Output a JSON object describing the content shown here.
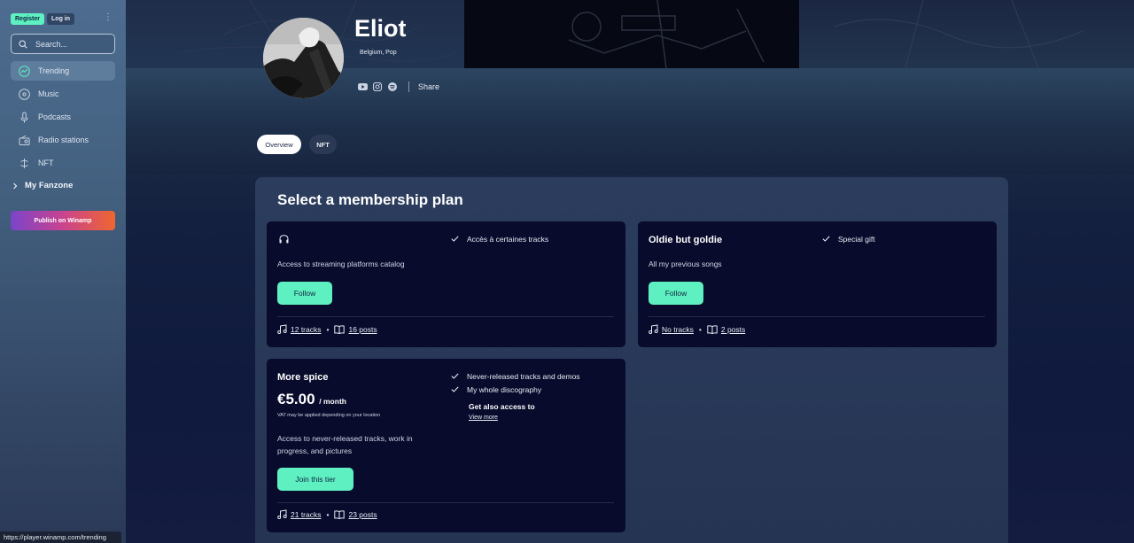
{
  "sidebar": {
    "register_label": "Register",
    "login_label": "Log in",
    "search_placeholder": "Search...",
    "items": [
      {
        "label": "Trending",
        "icon": "trending-icon",
        "active": true
      },
      {
        "label": "Music",
        "icon": "music-disc-icon",
        "active": false
      },
      {
        "label": "Podcasts",
        "icon": "microphone-icon",
        "active": false
      },
      {
        "label": "Radio stations",
        "icon": "radio-icon",
        "active": false
      },
      {
        "label": "NFT",
        "icon": "nft-icon",
        "active": false
      }
    ],
    "fanzone_label": "My Fanzone",
    "publish_label": "Publish on Winamp"
  },
  "status_bar": {
    "url": "https://player.winamp.com/trending"
  },
  "artist": {
    "name": "Eliot",
    "meta": "Belgium, Pop",
    "share_label": "Share",
    "socials": [
      "youtube-icon",
      "instagram-icon",
      "spotify-icon"
    ]
  },
  "tabs": [
    {
      "label": "Overview",
      "active": true
    },
    {
      "label": "NFT",
      "active": false
    }
  ],
  "membership": {
    "title": "Select a membership plan",
    "plans": [
      {
        "title": "",
        "icon": "headphones-icon",
        "features": [
          "Accès à certaines tracks"
        ],
        "description": "Access to streaming platforms catalog",
        "button_label": "Follow",
        "tracks_label": "12 tracks",
        "posts_label": "16 posts"
      },
      {
        "title": "Oldie but goldie",
        "features": [
          "Special gift"
        ],
        "description": "All my previous songs",
        "button_label": "Follow",
        "tracks_label": "No tracks",
        "posts_label": "2 posts"
      },
      {
        "title": "More spice",
        "price": "€5.00",
        "price_unit": "/ month",
        "vat_note": "VAT may be applied depending on your location",
        "features": [
          "Never-released tracks and demos",
          "My whole discography"
        ],
        "get_also_label": "Get also access to",
        "view_more_label": "View more",
        "description": "Access to never-released tracks, work in progress, and pictures",
        "button_label": "Join this tier",
        "tracks_label": "21 tracks",
        "posts_label": "23 posts"
      }
    ]
  },
  "colors": {
    "accent_mint": "#5ff0c1",
    "card_bg": "#080b2c",
    "panel_bg": "#2b3c5c"
  }
}
